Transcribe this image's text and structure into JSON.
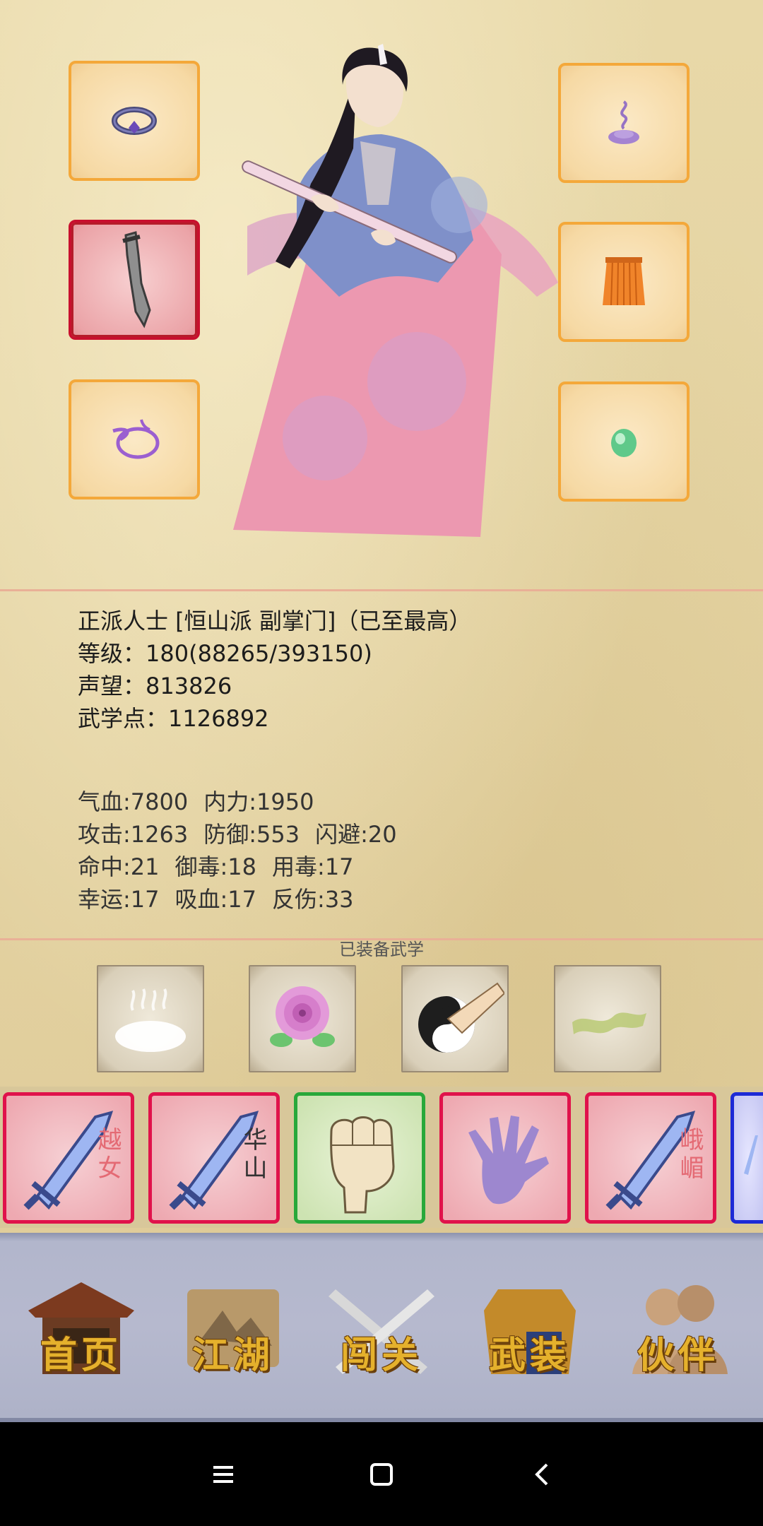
{
  "equipment": {
    "left_slots": [
      {
        "item": "ring",
        "icon": "ring-icon",
        "selected": false
      },
      {
        "item": "weapon",
        "icon": "saber-icon",
        "selected": true
      },
      {
        "item": "amulet",
        "icon": "loop-charm-icon",
        "selected": false
      }
    ],
    "right_slots": [
      {
        "item": "hairpiece",
        "icon": "incense-icon",
        "selected": false
      },
      {
        "item": "armor",
        "icon": "skirt-armor-icon",
        "selected": false
      },
      {
        "item": "jade",
        "icon": "jade-bead-icon",
        "selected": false
      }
    ]
  },
  "profile": {
    "title_line": "正派人士 [恒山派 副掌门]（已至最高）",
    "level_label": "等级：",
    "level_value": "180(88265/393150)",
    "prestige_label": "声望：",
    "prestige_value": "813826",
    "martial_points_label": "武学点：",
    "martial_points_value": "1126892"
  },
  "attributes": {
    "rows": [
      [
        "气血:7800",
        "内力:1950"
      ],
      [
        "攻击:1263",
        "防御:553",
        "闪避:20"
      ],
      [
        "命中:21",
        "御毒:18",
        "用毒:17"
      ],
      [
        "幸运:17",
        "吸血:17",
        "反伤:33"
      ]
    ]
  },
  "martial_arts": {
    "title": "已装备武学",
    "slots": [
      {
        "icon": "mist-cloud-icon"
      },
      {
        "icon": "peony-flower-icon"
      },
      {
        "icon": "taiji-palm-icon"
      },
      {
        "icon": "green-wind-icon"
      }
    ]
  },
  "skill_cards": [
    {
      "icon": "sword-icon",
      "label": "越女",
      "border": "red"
    },
    {
      "icon": "sword-icon",
      "label": "华山",
      "border": "red"
    },
    {
      "icon": "fist-icon",
      "label": "",
      "border": "green"
    },
    {
      "icon": "palm-icon",
      "label": "",
      "border": "red"
    },
    {
      "icon": "sword-icon",
      "label": "峨嵋",
      "border": "red"
    },
    {
      "icon": "sword-icon",
      "label": "",
      "border": "blue"
    }
  ],
  "nav": {
    "items": [
      {
        "label": "首页",
        "icon": "temple-icon"
      },
      {
        "label": "江湖",
        "icon": "scroll-icon"
      },
      {
        "label": "闯关",
        "icon": "crossed-swords-icon"
      },
      {
        "label": "武装",
        "icon": "armor-icon"
      },
      {
        "label": "伙伴",
        "icon": "companions-icon"
      }
    ]
  },
  "colors": {
    "slot_border": "#f4a83a",
    "selected_border": "#c8102e",
    "card_red": "#e0124b",
    "card_green": "#28a83a",
    "card_blue": "#1d2ad6",
    "nav_gold": "#e5b12c"
  }
}
